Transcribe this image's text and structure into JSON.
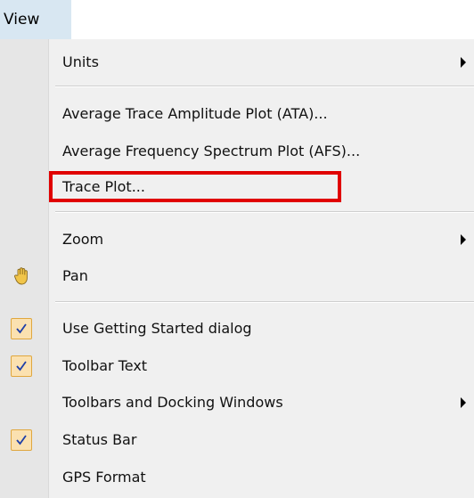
{
  "menubar": {
    "view_label": "View"
  },
  "menu": {
    "units": "Units",
    "ata": "Average Trace Amplitude Plot (ATA)...",
    "afs": "Average Frequency Spectrum Plot (AFS)...",
    "trace_plot": "Trace Plot...",
    "zoom": "Zoom",
    "pan": "Pan",
    "getting_started": "Use Getting Started dialog",
    "toolbar_text": "Toolbar Text",
    "toolbars_docking": "Toolbars and Docking Windows",
    "status_bar": "Status Bar",
    "gps_format": "GPS Format"
  },
  "colors": {
    "highlight": "#e00000",
    "check_bg": "#fbe1b0",
    "check_border": "#e0a73e",
    "menu_bg": "#f0f0f0",
    "menubar_active": "#d8e7f2"
  }
}
